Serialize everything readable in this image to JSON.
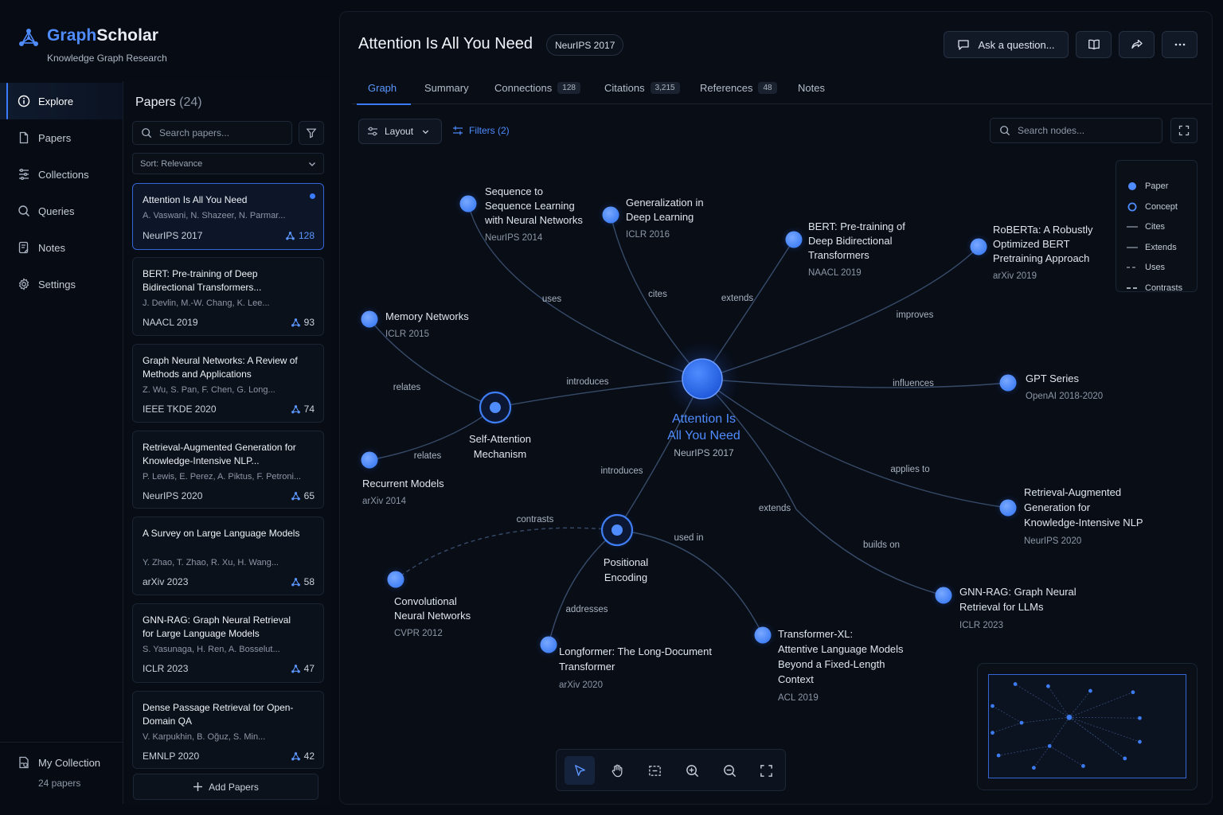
{
  "brand": {
    "name_a": "Graph",
    "name_b": "Scholar",
    "tagline": "Knowledge Graph Research"
  },
  "nav": {
    "items": [
      {
        "label": "Explore",
        "icon": "info-icon",
        "active": true
      },
      {
        "label": "Papers",
        "icon": "document-icon"
      },
      {
        "label": "Collections",
        "icon": "collections-icon"
      },
      {
        "label": "Queries",
        "icon": "search-icon"
      },
      {
        "label": "Notes",
        "icon": "notes-icon"
      },
      {
        "label": "Settings",
        "icon": "gear-icon"
      }
    ],
    "collection": {
      "label": "My Collection",
      "count": "24 papers",
      "icon": "collection-folder-icon"
    }
  },
  "papers_panel": {
    "title": "Papers",
    "count": "(24)",
    "search_placeholder": "Search papers...",
    "sort_label": "Sort: Relevance",
    "add_label": "Add Papers",
    "items": [
      {
        "title": "Attention Is All You Need",
        "authors": "A. Vaswani, N. Shazeer, N. Parmar...",
        "venue": "NeurIPS 2017",
        "connections": "128",
        "active": true
      },
      {
        "title": "BERT: Pre-training of Deep Bidirectional Transformers...",
        "authors": "J. Devlin, M.-W. Chang, K. Lee...",
        "venue": "NAACL 2019",
        "connections": "93"
      },
      {
        "title": "Graph Neural Networks: A Review of Methods and Applications",
        "authors": "Z. Wu, S. Pan, F. Chen, G. Long...",
        "venue": "IEEE TKDE 2020",
        "connections": "74"
      },
      {
        "title": "Retrieval-Augmented Generation for Knowledge-Intensive NLP...",
        "authors": "P. Lewis, E. Perez, A. Piktus, F. Petroni...",
        "venue": "NeurIPS 2020",
        "connections": "65"
      },
      {
        "title": "A Survey on Large Language Models",
        "authors": "Y. Zhao, T. Zhao, R. Xu, H. Wang...",
        "venue": "arXiv 2023",
        "connections": "58"
      },
      {
        "title": "GNN-RAG: Graph Neural Retrieval for Large Language Models",
        "authors": "S. Yasunaga, H. Ren, A. Bosselut...",
        "venue": "ICLR 2023",
        "connections": "47"
      },
      {
        "title": "Dense Passage Retrieval for Open-Domain QA",
        "authors": "V. Karpukhin, B. Oğuz, S. Min...",
        "venue": "EMNLP 2020",
        "connections": "42"
      }
    ]
  },
  "main": {
    "title": "Attention Is All You Need",
    "venue": "NeurIPS 2017",
    "ask_label": "Ask a question...",
    "tabs": [
      {
        "label": "Graph",
        "active": true
      },
      {
        "label": "Summary"
      },
      {
        "label": "Connections",
        "badge": "128"
      },
      {
        "label": "Citations",
        "badge": "3,215"
      },
      {
        "label": "References",
        "badge": "48"
      },
      {
        "label": "Notes"
      }
    ],
    "layout_label": "Layout",
    "filters_label": "Filters (2)",
    "node_search_placeholder": "Search nodes..."
  },
  "legend": {
    "items": [
      {
        "label": "Paper",
        "kind": "paper"
      },
      {
        "label": "Concept",
        "kind": "concept"
      },
      {
        "label": "Cites",
        "kind": "solid"
      },
      {
        "label": "Extends",
        "kind": "solid"
      },
      {
        "label": "Uses",
        "kind": "dashed"
      },
      {
        "label": "Contrasts",
        "kind": "dashed-bold"
      }
    ]
  },
  "graph": {
    "center": {
      "title": "Attention Is All You Need",
      "venue": "NeurIPS 2017"
    },
    "nodes": [
      {
        "id": "seq2seq",
        "title": "Sequence to Sequence Learning with Neural Networks",
        "venue": "NeurIPS 2014",
        "type": "paper"
      },
      {
        "id": "gen",
        "title": "Generalization in Deep Learning",
        "venue": "ICLR 2016",
        "type": "paper"
      },
      {
        "id": "bert",
        "title": "BERT: Pre-training of Deep Bidirectional Transformers",
        "venue": "NAACL 2019",
        "type": "paper"
      },
      {
        "id": "roberta",
        "title": "RoBERTa: A Robustly Optimized BERT Pretraining Approach",
        "venue": "arXiv 2019",
        "type": "paper"
      },
      {
        "id": "memnet",
        "title": "Memory Networks",
        "venue": "ICLR 2015",
        "type": "paper"
      },
      {
        "id": "gpt",
        "title": "GPT Series",
        "venue": "OpenAI 2018-2020",
        "type": "paper"
      },
      {
        "id": "selfatt",
        "title": "Self-Attention Mechanism",
        "venue": "",
        "type": "concept"
      },
      {
        "id": "rnn",
        "title": "Recurrent Models",
        "venue": "arXiv 2014",
        "type": "paper"
      },
      {
        "id": "rag",
        "title": "Retrieval-Augmented Generation for Knowledge-Intensive NLP",
        "venue": "NeurIPS 2020",
        "type": "paper"
      },
      {
        "id": "posenc",
        "title": "Positional Encoding",
        "venue": "",
        "type": "concept"
      },
      {
        "id": "cnn",
        "title": "Convolutional Neural Networks",
        "venue": "CVPR 2012",
        "type": "paper"
      },
      {
        "id": "gnnrag",
        "title": "GNN-RAG: Graph Neural Retrieval for LLMs",
        "venue": "ICLR 2023",
        "type": "paper"
      },
      {
        "id": "longformer",
        "title": "Longformer: The Long-Document Transformer",
        "venue": "arXiv 2020",
        "type": "paper"
      },
      {
        "id": "txl",
        "title": "Transformer-XL: Attentive Language Models Beyond a Fixed-Length Context",
        "venue": "ACL 2019",
        "type": "paper"
      }
    ],
    "edges": [
      {
        "from": "center",
        "to": "seq2seq",
        "label": "uses"
      },
      {
        "from": "center",
        "to": "gen",
        "label": "cites"
      },
      {
        "from": "center",
        "to": "bert",
        "label": "extends"
      },
      {
        "from": "center",
        "to": "roberta",
        "label": "improves"
      },
      {
        "from": "center",
        "to": "selfatt",
        "label": "introduces"
      },
      {
        "from": "center",
        "to": "gpt",
        "label": "influences"
      },
      {
        "from": "selfatt",
        "to": "memnet",
        "label": "relates"
      },
      {
        "from": "selfatt",
        "to": "rnn",
        "label": "relates"
      },
      {
        "from": "center",
        "to": "rag",
        "label": "applies to"
      },
      {
        "from": "center",
        "to": "posenc",
        "label": "introduces"
      },
      {
        "from": "posenc",
        "to": "cnn",
        "label": "contrasts"
      },
      {
        "from": "center",
        "to": "gnnrag",
        "label": "extends"
      },
      {
        "from": "center",
        "to": "gnnrag",
        "label": "builds on"
      },
      {
        "from": "posenc",
        "to": "longformer",
        "label": "addresses"
      },
      {
        "from": "posenc",
        "to": "txl",
        "label": "used in"
      }
    ]
  },
  "toolbar": {
    "tools": [
      {
        "name": "select-tool",
        "icon": "cursor-icon",
        "active": true
      },
      {
        "name": "pan-tool",
        "icon": "hand-icon"
      },
      {
        "name": "box-select-tool",
        "icon": "box-select-icon"
      },
      {
        "name": "zoom-in-tool",
        "icon": "zoom-in-icon"
      },
      {
        "name": "zoom-out-tool",
        "icon": "zoom-out-icon"
      },
      {
        "name": "fit-view-tool",
        "icon": "fit-view-icon"
      }
    ]
  },
  "colors": {
    "accent": "#3b7bff",
    "node": "#4f8cff",
    "background": "#070b13"
  }
}
